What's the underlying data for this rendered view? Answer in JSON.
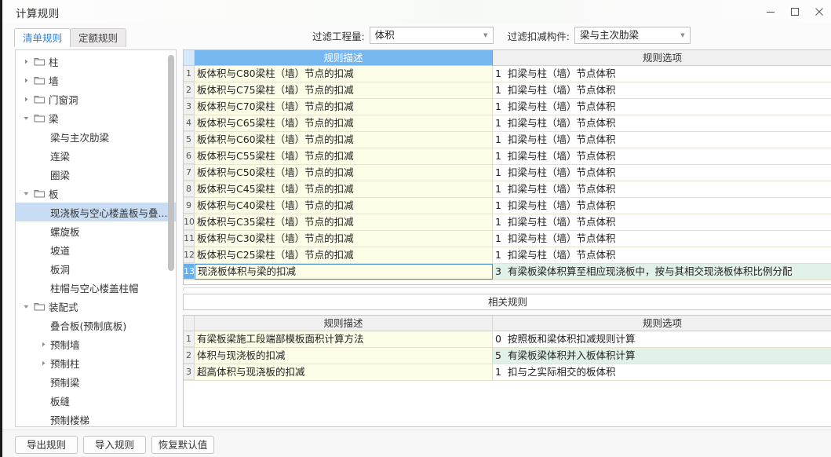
{
  "window": {
    "title": "计算规则",
    "controls": [
      {
        "name": "minimize",
        "glyph": "—"
      },
      {
        "name": "maximize",
        "glyph": "□"
      },
      {
        "name": "close",
        "glyph": "✕"
      }
    ]
  },
  "tabs": [
    {
      "label": "清单规则",
      "active": true
    },
    {
      "label": "定额规则",
      "active": false
    }
  ],
  "filters": [
    {
      "label": "过滤工程量:",
      "value": "体积"
    },
    {
      "label": "过滤扣减构件:",
      "value": "梁与主次肋梁"
    }
  ],
  "tree": [
    {
      "label": "柱",
      "indent": 0,
      "arrow": "collapsed",
      "folder": true,
      "selected": false
    },
    {
      "label": "墙",
      "indent": 0,
      "arrow": "collapsed",
      "folder": true,
      "selected": false
    },
    {
      "label": "门窗洞",
      "indent": 0,
      "arrow": "collapsed",
      "folder": true,
      "selected": false
    },
    {
      "label": "梁",
      "indent": 0,
      "arrow": "expanded",
      "folder": true,
      "selected": false
    },
    {
      "label": "梁与主次肋梁",
      "indent": 1,
      "arrow": "none",
      "folder": false,
      "selected": false
    },
    {
      "label": "连梁",
      "indent": 1,
      "arrow": "none",
      "folder": false,
      "selected": false
    },
    {
      "label": "圈梁",
      "indent": 1,
      "arrow": "none",
      "folder": false,
      "selected": false
    },
    {
      "label": "板",
      "indent": 0,
      "arrow": "expanded",
      "folder": true,
      "selected": false
    },
    {
      "label": "现浇板与空心楼盖板与叠...",
      "indent": 1,
      "arrow": "none",
      "folder": false,
      "selected": true
    },
    {
      "label": "螺旋板",
      "indent": 1,
      "arrow": "none",
      "folder": false,
      "selected": false
    },
    {
      "label": "坡道",
      "indent": 1,
      "arrow": "none",
      "folder": false,
      "selected": false
    },
    {
      "label": "板洞",
      "indent": 1,
      "arrow": "none",
      "folder": false,
      "selected": false
    },
    {
      "label": "柱帽与空心楼盖柱帽",
      "indent": 1,
      "arrow": "none",
      "folder": false,
      "selected": false
    },
    {
      "label": "装配式",
      "indent": 0,
      "arrow": "expanded",
      "folder": true,
      "selected": false
    },
    {
      "label": "叠合板(预制底板)",
      "indent": 1,
      "arrow": "none",
      "folder": false,
      "selected": false
    },
    {
      "label": "预制墙",
      "indent": 1,
      "arrow": "collapsed",
      "folder": false,
      "selected": false
    },
    {
      "label": "预制柱",
      "indent": 1,
      "arrow": "collapsed",
      "folder": false,
      "selected": false
    },
    {
      "label": "预制梁",
      "indent": 1,
      "arrow": "none",
      "folder": false,
      "selected": false
    },
    {
      "label": "板缝",
      "indent": 1,
      "arrow": "none",
      "folder": false,
      "selected": false
    },
    {
      "label": "预制楼梯",
      "indent": 1,
      "arrow": "none",
      "folder": false,
      "selected": false
    }
  ],
  "main_grid": {
    "headers": {
      "desc": "规则描述",
      "option": "规则选项"
    },
    "rows": [
      {
        "num": "1",
        "desc": "板体积与C80梁柱（墙）节点的扣减",
        "opt_id": "1",
        "opt_text": "扣梁与柱（墙）节点体积",
        "selected": false,
        "green": false
      },
      {
        "num": "2",
        "desc": "板体积与C75梁柱（墙）节点的扣减",
        "opt_id": "1",
        "opt_text": "扣梁与柱（墙）节点体积",
        "selected": false,
        "green": false
      },
      {
        "num": "3",
        "desc": "板体积与C70梁柱（墙）节点的扣减",
        "opt_id": "1",
        "opt_text": "扣梁与柱（墙）节点体积",
        "selected": false,
        "green": false
      },
      {
        "num": "4",
        "desc": "板体积与C65梁柱（墙）节点的扣减",
        "opt_id": "1",
        "opt_text": "扣梁与柱（墙）节点体积",
        "selected": false,
        "green": false
      },
      {
        "num": "5",
        "desc": "板体积与C60梁柱（墙）节点的扣减",
        "opt_id": "1",
        "opt_text": "扣梁与柱（墙）节点体积",
        "selected": false,
        "green": false
      },
      {
        "num": "6",
        "desc": "板体积与C55梁柱（墙）节点的扣减",
        "opt_id": "1",
        "opt_text": "扣梁与柱（墙）节点体积",
        "selected": false,
        "green": false
      },
      {
        "num": "7",
        "desc": "板体积与C50梁柱（墙）节点的扣减",
        "opt_id": "1",
        "opt_text": "扣梁与柱（墙）节点体积",
        "selected": false,
        "green": false
      },
      {
        "num": "8",
        "desc": "板体积与C45梁柱（墙）节点的扣减",
        "opt_id": "1",
        "opt_text": "扣梁与柱（墙）节点体积",
        "selected": false,
        "green": false
      },
      {
        "num": "9",
        "desc": "板体积与C40梁柱（墙）节点的扣减",
        "opt_id": "1",
        "opt_text": "扣梁与柱（墙）节点体积",
        "selected": false,
        "green": false
      },
      {
        "num": "10",
        "desc": "板体积与C35梁柱（墙）节点的扣减",
        "opt_id": "1",
        "opt_text": "扣梁与柱（墙）节点体积",
        "selected": false,
        "green": false
      },
      {
        "num": "11",
        "desc": "板体积与C30梁柱（墙）节点的扣减",
        "opt_id": "1",
        "opt_text": "扣梁与柱（墙）节点体积",
        "selected": false,
        "green": false
      },
      {
        "num": "12",
        "desc": "板体积与C25梁柱（墙）节点的扣减",
        "opt_id": "1",
        "opt_text": "扣梁与柱（墙）节点体积",
        "selected": false,
        "green": false
      },
      {
        "num": "13",
        "desc": "现浇板体积与梁的扣减",
        "opt_id": "3",
        "opt_text": "有梁板梁体积算至相应现浇板中，按与其相交现浇板体积比例分配",
        "selected": true,
        "green": true
      }
    ]
  },
  "related_bar_label": "相关规则",
  "related_grid": {
    "headers": {
      "desc": "规则描述",
      "option": "规则选项"
    },
    "rows": [
      {
        "num": "1",
        "desc": "有梁板梁施工段端部模板面积计算方法",
        "opt_id": "0",
        "opt_text": "按照板和梁体积扣减规则计算",
        "green": false
      },
      {
        "num": "2",
        "desc": "体积与现浇板的扣减",
        "opt_id": "5",
        "opt_text": "有梁板梁体积并入板体积计算",
        "green": true
      },
      {
        "num": "3",
        "desc": "超高体积与现浇板的扣减",
        "opt_id": "1",
        "opt_text": "扣与之实际相交的板体积",
        "green": false
      }
    ]
  },
  "footer_buttons": [
    {
      "label": "导出规则"
    },
    {
      "label": "导入规则"
    },
    {
      "label": "恢复默认值"
    }
  ]
}
